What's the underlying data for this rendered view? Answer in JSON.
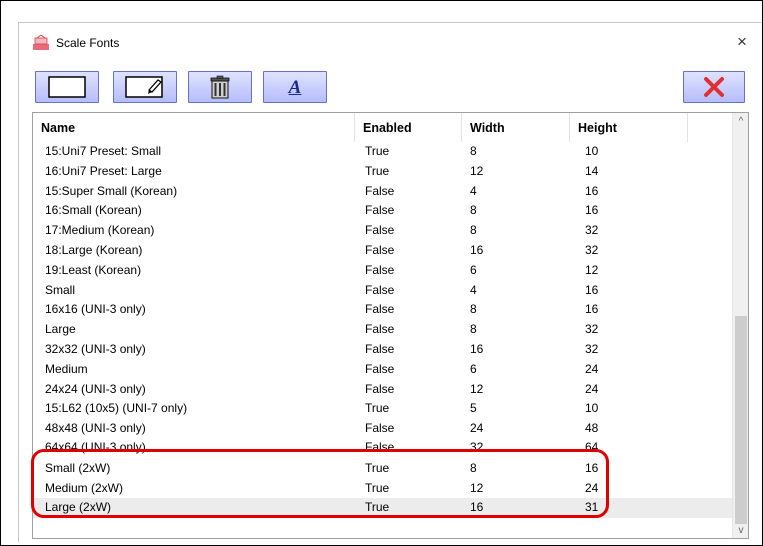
{
  "window": {
    "title": "Scale Fonts",
    "close_glyph": "×"
  },
  "toolbar": {
    "buttons": [
      {
        "name": "new-icon"
      },
      {
        "name": "edit-icon"
      },
      {
        "name": "delete-icon"
      },
      {
        "name": "font-icon",
        "glyph": "A"
      }
    ],
    "cancel": {
      "name": "cancel-icon",
      "color": "#e03030"
    }
  },
  "table": {
    "columns": [
      "Name",
      "Enabled",
      "Width",
      "Height"
    ],
    "rows": [
      [
        "15:Uni7 Preset: Small",
        "True",
        "8",
        "10"
      ],
      [
        "16:Uni7 Preset: Large",
        "True",
        "12",
        "14"
      ],
      [
        "15:Super Small (Korean)",
        "False",
        "4",
        "16"
      ],
      [
        "16:Small (Korean)",
        "False",
        "8",
        "16"
      ],
      [
        "17:Medium (Korean)",
        "False",
        "8",
        "32"
      ],
      [
        "18:Large (Korean)",
        "False",
        "16",
        "32"
      ],
      [
        "19:Least (Korean)",
        "False",
        "6",
        "12"
      ],
      [
        "Small",
        "False",
        "4",
        "16"
      ],
      [
        "16x16 (UNI-3 only)",
        "False",
        "8",
        "16"
      ],
      [
        "Large",
        "False",
        "8",
        "32"
      ],
      [
        "32x32 (UNI-3 only)",
        "False",
        "16",
        "32"
      ],
      [
        "Medium",
        "False",
        "6",
        "24"
      ],
      [
        "24x24 (UNI-3 only)",
        "False",
        "12",
        "24"
      ],
      [
        "15:L62 (10x5) (UNI-7 only)",
        "True",
        "5",
        "10"
      ],
      [
        "48x48 (UNI-3 only)",
        "False",
        "24",
        "48"
      ],
      [
        "64x64 (UNI-3 only)",
        "False",
        "32",
        "64"
      ],
      [
        "Small (2xW)",
        "True",
        "8",
        "16"
      ],
      [
        "Medium (2xW)",
        "True",
        "12",
        "24"
      ],
      [
        "Large (2xW)",
        "True",
        "16",
        "31"
      ]
    ]
  },
  "scrollbar": {
    "up_glyph": "^",
    "down_glyph": "v"
  },
  "colors": {
    "highlight": "#e00000",
    "button_fill": "#b5bdfb"
  }
}
